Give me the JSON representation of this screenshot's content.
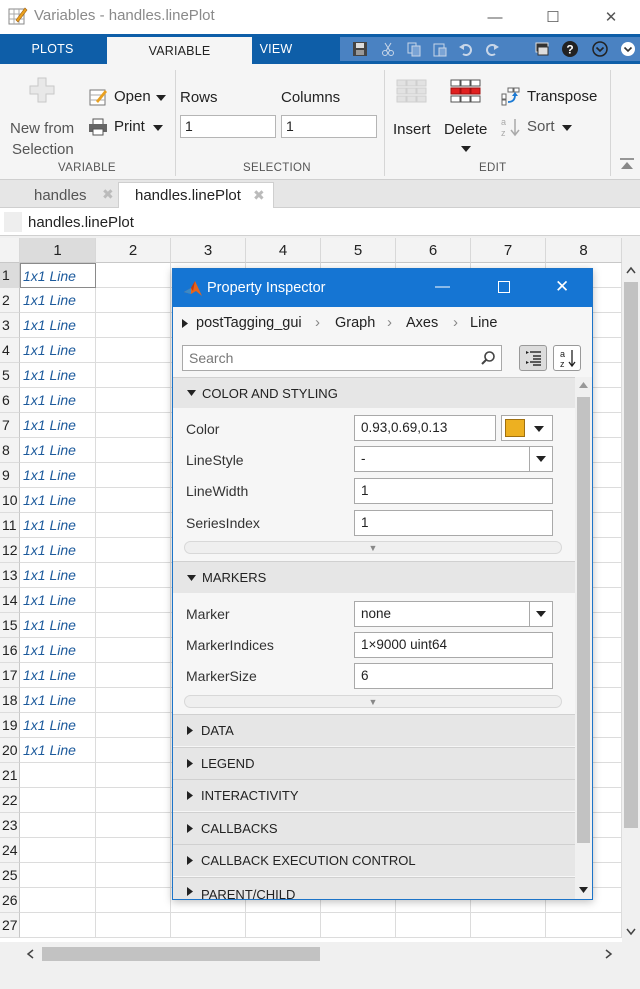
{
  "window": {
    "title": "Variables - handles.linePlot",
    "minimize": "—",
    "maximize": "☐",
    "close": "✕"
  },
  "ribbon_tabs": [
    "PLOTS",
    "VARIABLE",
    "VIEW"
  ],
  "ribbon": {
    "variable": {
      "new_line1": "New from",
      "new_line2": "Selection",
      "open": "Open",
      "print": "Print",
      "group": "VARIABLE"
    },
    "selection": {
      "rows_label": "Rows",
      "columns_label": "Columns",
      "rows_value": "1",
      "columns_value": "1",
      "group": "SELECTION"
    },
    "edit": {
      "insert": "Insert",
      "delete": "Delete",
      "transpose": "Transpose",
      "sort": "Sort",
      "group": "EDIT"
    }
  },
  "doc_tabs": [
    {
      "label": "handles"
    },
    {
      "label": "handles.linePlot"
    }
  ],
  "breadcrumb": "handles.linePlot",
  "grid": {
    "columns": [
      "1",
      "2",
      "3",
      "4",
      "5",
      "6",
      "7",
      "8"
    ],
    "rows": [
      "1",
      "2",
      "3",
      "4",
      "5",
      "6",
      "7",
      "8",
      "9",
      "10",
      "11",
      "12",
      "13",
      "14",
      "15",
      "16",
      "17",
      "18",
      "19",
      "20",
      "21",
      "22",
      "23",
      "24",
      "25",
      "26",
      "27"
    ],
    "cells": [
      "1x1 Line",
      "1x1 Line",
      "1x1 Line",
      "1x1 Line",
      "1x1 Line",
      "1x1 Line",
      "1x1 Line",
      "1x1 Line",
      "1x1 Line",
      "1x1 Line",
      "1x1 Line",
      "1x1 Line",
      "1x1 Line",
      "1x1 Line",
      "1x1 Line",
      "1x1 Line",
      "1x1 Line",
      "1x1 Line",
      "1x1 Line",
      "1x1 Line"
    ]
  },
  "inspector": {
    "title": "Property Inspector",
    "path": [
      "postTagging_gui",
      "Graph",
      "Axes",
      "Line"
    ],
    "search_placeholder": "Search",
    "sections": {
      "color_styling": "COLOR AND STYLING",
      "markers": "MARKERS",
      "collapsed": [
        "DATA",
        "LEGEND",
        "INTERACTIVITY",
        "CALLBACKS",
        "CALLBACK EXECUTION CONTROL",
        "PARENT/CHILD"
      ]
    },
    "props": {
      "color": {
        "label": "Color",
        "value": "0.93,0.69,0.13",
        "swatch": "#EDB021"
      },
      "linestyle": {
        "label": "LineStyle",
        "value": "-"
      },
      "linewidth": {
        "label": "LineWidth",
        "value": "1"
      },
      "seriesindex": {
        "label": "SeriesIndex",
        "value": "1"
      },
      "marker": {
        "label": "Marker",
        "value": "none"
      },
      "markerindices": {
        "label": "MarkerIndices",
        "value": "1×9000 uint64"
      },
      "markersize": {
        "label": "MarkerSize",
        "value": "6"
      }
    }
  },
  "colors": {
    "ribbon_blue": "#0E5EA8",
    "inspector_title": "#1575D3",
    "cell_text": "#1C5A9C"
  }
}
